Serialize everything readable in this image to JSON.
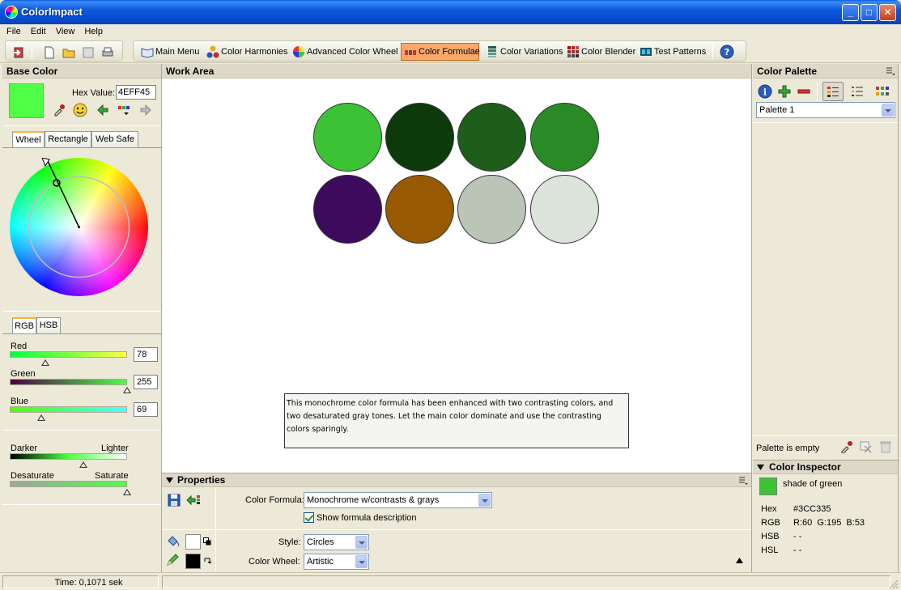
{
  "window": {
    "title": "ColorImpact"
  },
  "menu": [
    "File",
    "Edit",
    "View",
    "Help"
  ],
  "toolbar": {
    "tabs": [
      {
        "label": "Main Menu",
        "icon": "book-icon"
      },
      {
        "label": "Color Harmonies",
        "icon": "harmony-dots-icon"
      },
      {
        "label": "Advanced Color Wheel",
        "icon": "color-wheel-icon"
      },
      {
        "label": "Color Formulae",
        "icon": "formula-icon",
        "active": true
      },
      {
        "label": "Color Variations",
        "icon": "variations-icon"
      },
      {
        "label": "Color Blender",
        "icon": "blender-grid-icon"
      },
      {
        "label": "Test Patterns",
        "icon": "test-pattern-icon"
      }
    ]
  },
  "base_color": {
    "title": "Base Color",
    "hex_label": "Hex Value:",
    "hex_value": "4EFF45",
    "color": "#4EFF45",
    "picker_tabs": [
      "Wheel",
      "Rectangle",
      "Web Safe"
    ],
    "mode_tabs": [
      "RGB",
      "HSB"
    ],
    "sliders": {
      "red": {
        "label": "Red",
        "value": "78",
        "fraction": 0.306
      },
      "green": {
        "label": "Green",
        "value": "255",
        "fraction": 1.0
      },
      "blue": {
        "label": "Blue",
        "value": "69",
        "fraction": 0.27
      }
    },
    "darker_label": "Darker",
    "lighter_label": "Lighter",
    "desaturate_label": "Desaturate",
    "saturate_label": "Saturate",
    "lightness_fraction": 0.63,
    "saturation_fraction": 1.0
  },
  "work_area": {
    "title": "Work Area",
    "circles": [
      "#3CC335",
      "#0D3A0B",
      "#1D5E1A",
      "#2A8A26",
      "#3E0A5E",
      "#985A00",
      "#BAC5B8",
      "#DCE3DB"
    ],
    "description": "This monochrome color formula has been enhanced with two contrasting colors, and two desaturated gray tones. Let the main color dominate and use the contrasting colors sparingly."
  },
  "properties": {
    "title": "Properties",
    "formula_label": "Color Formula:",
    "formula_value": "Monochrome w/contrasts & grays",
    "show_desc_label": "Show formula description",
    "style_label": "Style:",
    "style_value": "Circles",
    "wheel_label": "Color Wheel:",
    "wheel_value": "Artistic"
  },
  "palette": {
    "title": "Color Palette",
    "selected": "Palette 1",
    "empty_text": "Palette is empty"
  },
  "inspector": {
    "title": "Color Inspector",
    "swatch": "#3CC335",
    "name": "shade of green",
    "rows": [
      {
        "label": "Hex",
        "value": "#3CC335"
      },
      {
        "label": "RGB",
        "value": "R:60  G:195  B:53"
      },
      {
        "label": "HSB",
        "value": "- -"
      },
      {
        "label": "HSL",
        "value": "- -"
      }
    ]
  },
  "status": {
    "time": "Time: 0,1071 sek"
  }
}
